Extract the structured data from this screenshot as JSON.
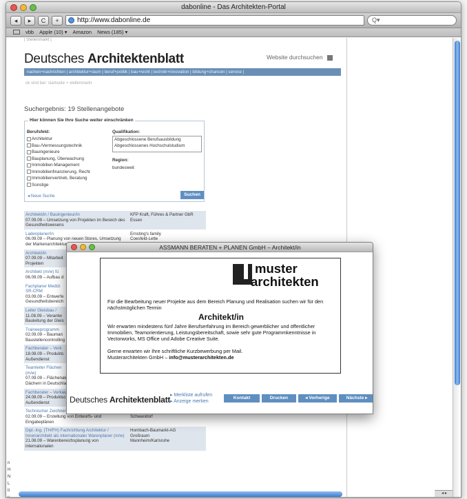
{
  "browser": {
    "window_title": "dabonline - Das Architekten-Portal",
    "url": "http://www.dabonline.de",
    "search_placeholder": "Q▾",
    "back": "◂",
    "forward": "▸",
    "reload": "C",
    "add": "+",
    "bookmarks": [
      "vbb",
      "Apple (10) ▾",
      "Amazon",
      "News (185) ▾"
    ]
  },
  "page": {
    "breadcrumb_top": "| Stellenmarkt |",
    "logo_prefix": "Deutsches ",
    "logo_bold": "Architektenblatt",
    "site_search": "Website durchsuchen",
    "nav": "nachen+nachrichten | architektur+raum | beruf+politik | bau+recht | technik+innovation | bildung+chancen | service |",
    "subnav": "ok sind bar: startseite  + stellenmarkt",
    "result_heading": "Suchergebnis: 19 Stellenangebote",
    "filter": {
      "legend": "Hier können Sie Ihre Suche weiter einschränken",
      "berufsfeld_label": "Berufsfeld:",
      "berufsfeld_items": [
        "Architektur",
        "Bau-/Vermessungstechnik",
        "Bauingenieure",
        "Bauplanung, Überwachung",
        "Immobilien-Management",
        "Immobilienfinanzierung, Recht",
        "Immobilienvertrieb, Beratung",
        "Sonstige"
      ],
      "qualifikation_label": "Qualifikation:",
      "qualifikation_items": [
        "Abgeschlossene Berufsausbildung",
        "Abgeschlossenes Hochschulstudium"
      ],
      "region_label": "Region:",
      "region_value": "bundesweit",
      "new_search": "◂ Neue Suche",
      "search_button": "Suchen"
    },
    "results": [
      {
        "title": "Architekt/in / Bauingenieur/in",
        "desc": "07.09.09 – Umsetzung von Projekten im Bereich des Gesundheitswesens",
        "company": "KFP Kraft, Führes & Partner GbR\nEssen",
        "shade": true
      },
      {
        "title": "Ladenplaner/in",
        "desc": "06.09.09 – Planung von neuen Stores, Umsetzung der Markenarchitektur",
        "company": "Ernsting's family\nCoesfeld-Lette",
        "shade": false
      },
      {
        "title": "Architekt/in",
        "desc": "07.09.09 – Mitarbeit\nProjekten",
        "company": "",
        "shade": true
      },
      {
        "title": "Architekt (m/w) fü",
        "desc": "06.09.09 – Aufbau d",
        "company": "",
        "shade": false
      },
      {
        "title": "Fachplaner Medizi\nSR-CRM",
        "desc": "03.09.09 – Entwerfe\nGesundheitsbereich",
        "company": "",
        "shade": false
      },
      {
        "title": "Leiter Gleisbau /",
        "desc": "11.08.09 – Verantw\nBauleitung der Gleis",
        "company": "",
        "shade": true
      },
      {
        "title": "Traineeprogramm",
        "desc": "02.09.09 – Bauman\nBaustellencontrolling",
        "company": "",
        "shade": false
      },
      {
        "title": "Fachberater – Verk",
        "desc": "18.08.09 – Produkts\nAußendienst",
        "company": "",
        "shade": true
      },
      {
        "title": "Teamleiter Flächen\n(m/w)",
        "desc": "07.09.09 – Flächenakquise von Freiflächen und Dächern in Deutschland",
        "company": "Niederlassung Leipzig",
        "shade": false
      },
      {
        "title": "Fachberater – Verkauf und Beratung (m/w)",
        "desc": "24.08.09 – Produktschulungen und Vertrieb im Außendienst",
        "company": "RHEINZINK GmbH & Co. KG\nNiederlassung Ulm, Vertriebsgebiet Baden",
        "shade": true
      },
      {
        "title": "Technischer Zeichner im Anlagenbau (m/w)",
        "desc": "02.09.09 – Erstellung von Entwurfs- und Eingabeplänen",
        "company": "Schmack Biogas AG\nSchwandorf",
        "shade": false
      },
      {
        "title": "Dipl.-Ing. (TH/FH) Fachrichtung Architektur / Innenarchitekt als internationaler Warenplaner (m/w)",
        "desc": "21.08.09 – Warenbereichsplanung von internationalen",
        "company": "Hornbach-Baumarkt-AG\nGroßraum\nMannheim/Karlsruhe",
        "shade": true
      }
    ],
    "side_marks": [
      "n",
      "H",
      "N",
      "L",
      "ti",
      "v"
    ]
  },
  "popup": {
    "window_title": "ASSMANN BERATEN + PLANEN GmbH – Architekt/in",
    "logo_line1": "muster",
    "logo_line2": "architekten",
    "intro": "Für die Bearbeitung neuer Projekte aus dem Bereich Planung und Realisation suchen wir für den nächstmöglichen Termin",
    "job_title": "Architekt/in",
    "requirements": "Wir erwarten mindestens fünf Jahre Berufserfahrung im Bereich gewerblicher und öffentlicher Immobilien, Teamorientierung, Leistungsbereitschaft, sowie sehr gute Programmkenntnisse in Vectorworks, MS Office und Adobe Creative Suite.",
    "closing_line1": "Gerne erwarten wir Ihre schriftliche Kurzbewerbung per Mail.",
    "closing_company": "Musterarchitekten GmbH – ",
    "closing_email": "info@musterarchitekten.de",
    "footer_logo_prefix": "Deutsches ",
    "footer_logo_bold": "Architektenblatt",
    "link_merkliste": "▸ Merkliste aufrufen",
    "link_anzeige": "▸ Anzeige merken",
    "btn_kontakt": "Kontakt",
    "btn_drucken": "Drucken",
    "btn_vorherige": "◂ Vorherige",
    "btn_naechste": "Nächste ▸"
  }
}
